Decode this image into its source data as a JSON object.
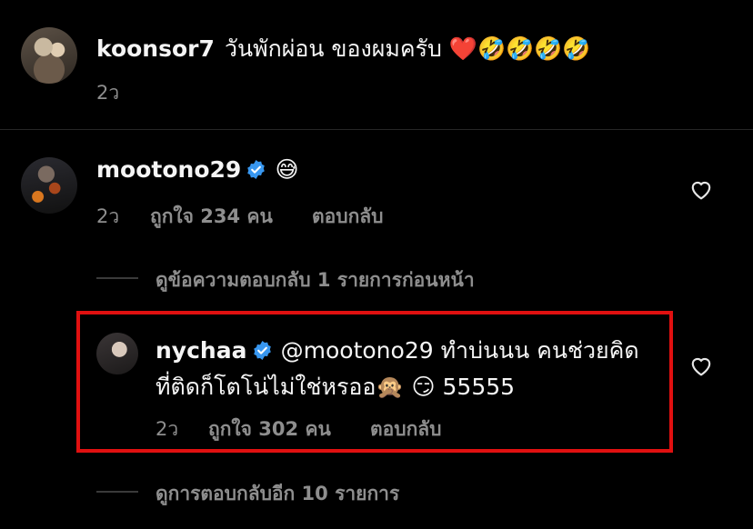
{
  "comments": [
    {
      "username": "koonsor7",
      "text": "วันพักผ่อน ของผมครับ ❤️🤣🤣🤣🤣",
      "time": "2ว"
    },
    {
      "username": "mootono29",
      "verified": true,
      "text": "😅",
      "time": "2ว",
      "likes": "ถูกใจ 234 คน",
      "reply_label": "ตอบกลับ"
    }
  ],
  "view_previous_replies": "ดูข้อความตอบกลับ 1 รายการก่อนหน้า",
  "reply": {
    "username": "nychaa",
    "verified": true,
    "text_line1": "@mootono29 ทำบ่นนน คนช่วยคิด",
    "text_line2": "ที่ติดก็โตโน่ไม่ใช่หรออ🙊 😏 55555",
    "time": "2ว",
    "likes": "ถูกใจ 302 คน",
    "reply_label": "ตอบกลับ",
    "highlight_color": "#e01010"
  },
  "view_more_replies": "ดูการตอบกลับอีก 10 รายการ",
  "colors": {
    "background": "#000000",
    "text": "#f5f5f5",
    "muted": "#8e8e8e",
    "verified": "#3897f0"
  }
}
